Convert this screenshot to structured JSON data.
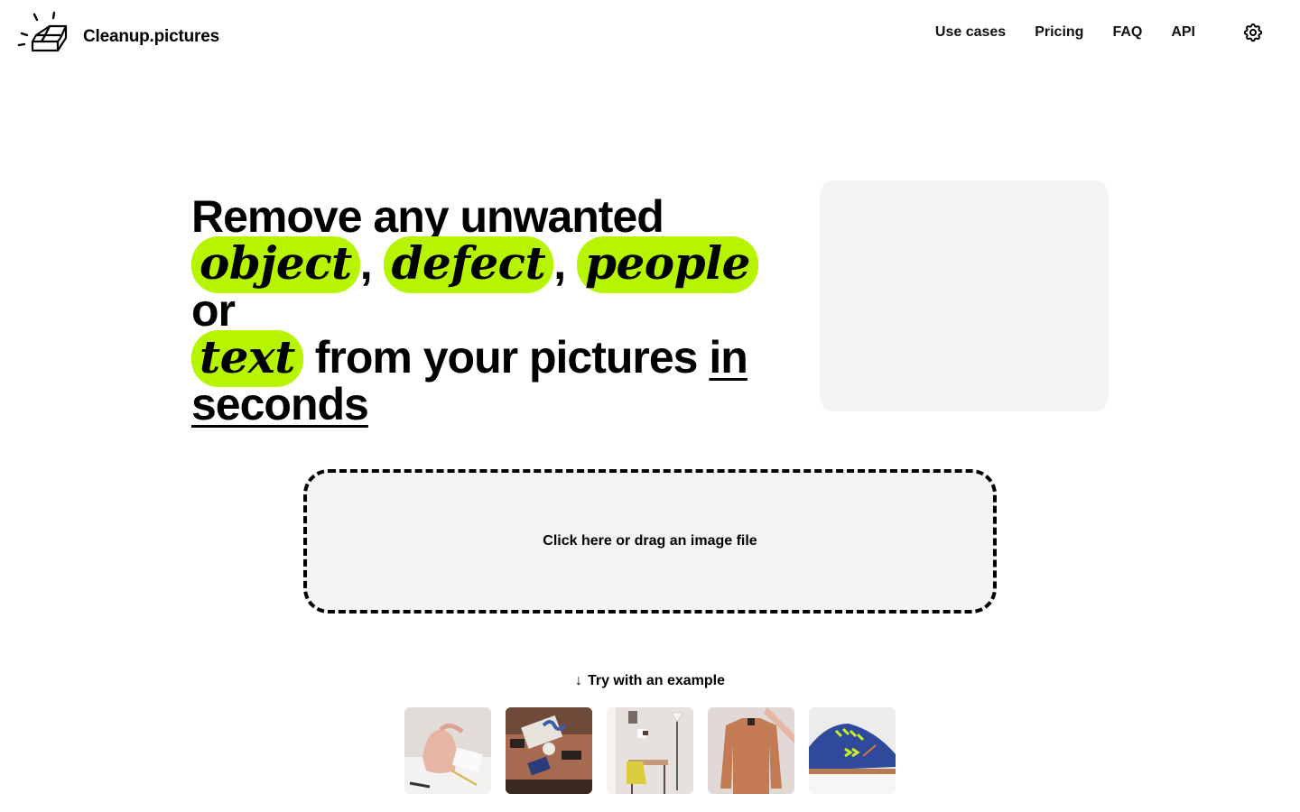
{
  "header": {
    "brand": "Cleanup.pictures",
    "logo_icon": "eraser-icon",
    "nav": [
      {
        "label": "Use cases"
      },
      {
        "label": "Pricing"
      },
      {
        "label": "FAQ"
      },
      {
        "label": "API"
      }
    ],
    "settings_icon": "gear-icon"
  },
  "hero": {
    "line1": "Remove any unwanted",
    "highlight_words": [
      "object",
      "defect",
      "people",
      "text"
    ],
    "comma": ",",
    "or_word": "or",
    "line3_rest": "from your pictures",
    "underlined": "in seconds",
    "underlined_part1": "in",
    "underlined_part2": "seconds",
    "highlight_color": "#b6f400"
  },
  "dropzone": {
    "label": "Click here or drag an image file"
  },
  "examples": {
    "label": "Try with an example",
    "arrow_icon": "arrow-down-icon",
    "items": [
      {
        "name": "pink backpack"
      },
      {
        "name": "desk flatlay"
      },
      {
        "name": "room with yellow chair"
      },
      {
        "name": "brown jacket"
      },
      {
        "name": "blue sneaker"
      }
    ]
  }
}
